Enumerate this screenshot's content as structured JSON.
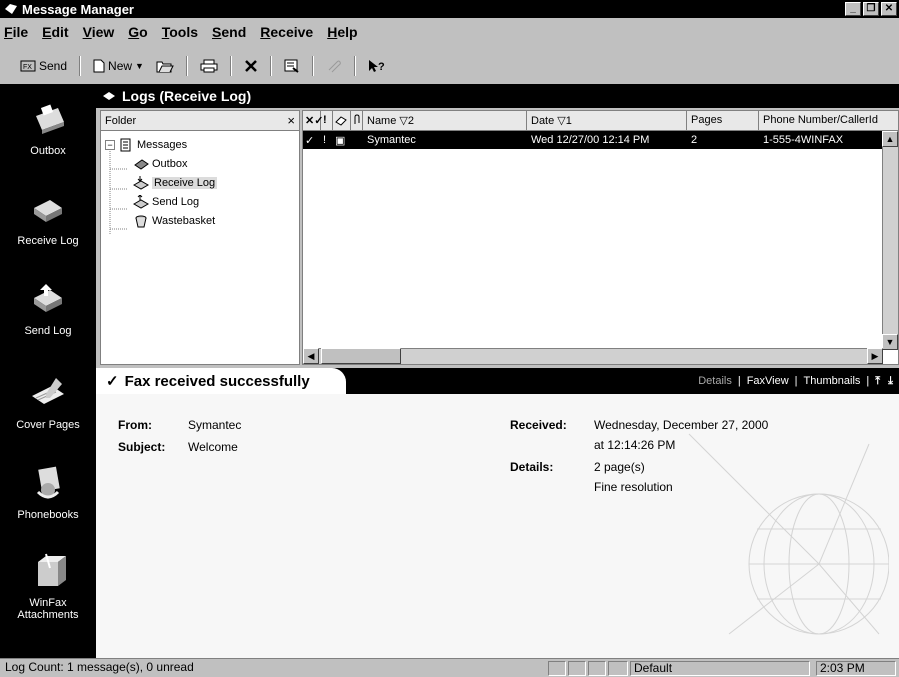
{
  "window": {
    "title": "Message Manager"
  },
  "menu": [
    {
      "label": "File",
      "u": "F",
      "rest": "ile"
    },
    {
      "label": "Edit",
      "u": "E",
      "rest": "dit"
    },
    {
      "label": "View",
      "u": "V",
      "rest": "iew"
    },
    {
      "label": "Go",
      "u": "G",
      "rest": "o"
    },
    {
      "label": "Tools",
      "u": "T",
      "rest": "ools"
    },
    {
      "label": "Send",
      "u": "S",
      "rest": "end"
    },
    {
      "label": "Receive",
      "u": "R",
      "rest": "eceive"
    },
    {
      "label": "Help",
      "u": "H",
      "rest": "elp"
    }
  ],
  "toolbar": {
    "send_label": "Send",
    "new_label": "New"
  },
  "nav": [
    {
      "label": "Outbox",
      "icon": "fax-machine-icon"
    },
    {
      "label": "Receive Log",
      "icon": "receive-log-icon"
    },
    {
      "label": "Send Log",
      "icon": "send-log-icon"
    },
    {
      "label": "Cover Pages",
      "icon": "cover-pages-icon"
    },
    {
      "label": "Phonebooks",
      "icon": "phonebook-icon"
    },
    {
      "label": "WinFax",
      "label2": "Attachments",
      "icon": "attachments-icon"
    }
  ],
  "logs": {
    "title": "Logs (Receive Log)"
  },
  "folder": {
    "header": "Folder",
    "close": "×",
    "root": "Messages",
    "children": [
      "Outbox",
      "Receive Log",
      "Send Log",
      "Wastebasket"
    ]
  },
  "list": {
    "columns": {
      "name": "Name ▽2",
      "date": "Date ▽1",
      "pages": "Pages",
      "phone": "Phone Number/CallerId"
    },
    "rows": [
      {
        "name": "Symantec",
        "date": "Wed 12/27/00 12:14 PM",
        "pages": "2",
        "phone": "1-555-4WINFAX"
      }
    ]
  },
  "preview": {
    "status": "Fax received successfully",
    "links": [
      "Details",
      "FaxView",
      "Thumbnails"
    ],
    "from_label": "From:",
    "from_value": "Symantec",
    "subject_label": "Subject:",
    "subject_value": "Welcome",
    "received_label": "Received:",
    "received_value": "Wednesday, December 27, 2000",
    "received_time": "at 12:14:26 PM",
    "details_label": "Details:",
    "details_pages": "2 page(s)",
    "details_res": "Fine resolution"
  },
  "statusbar": {
    "count": "Log Count: 1 message(s), 0 unread",
    "profile": "Default",
    "time": "2:03 PM"
  },
  "colors": {
    "black": "#000000",
    "face": "#c0c0c0",
    "selection": "#000000"
  }
}
